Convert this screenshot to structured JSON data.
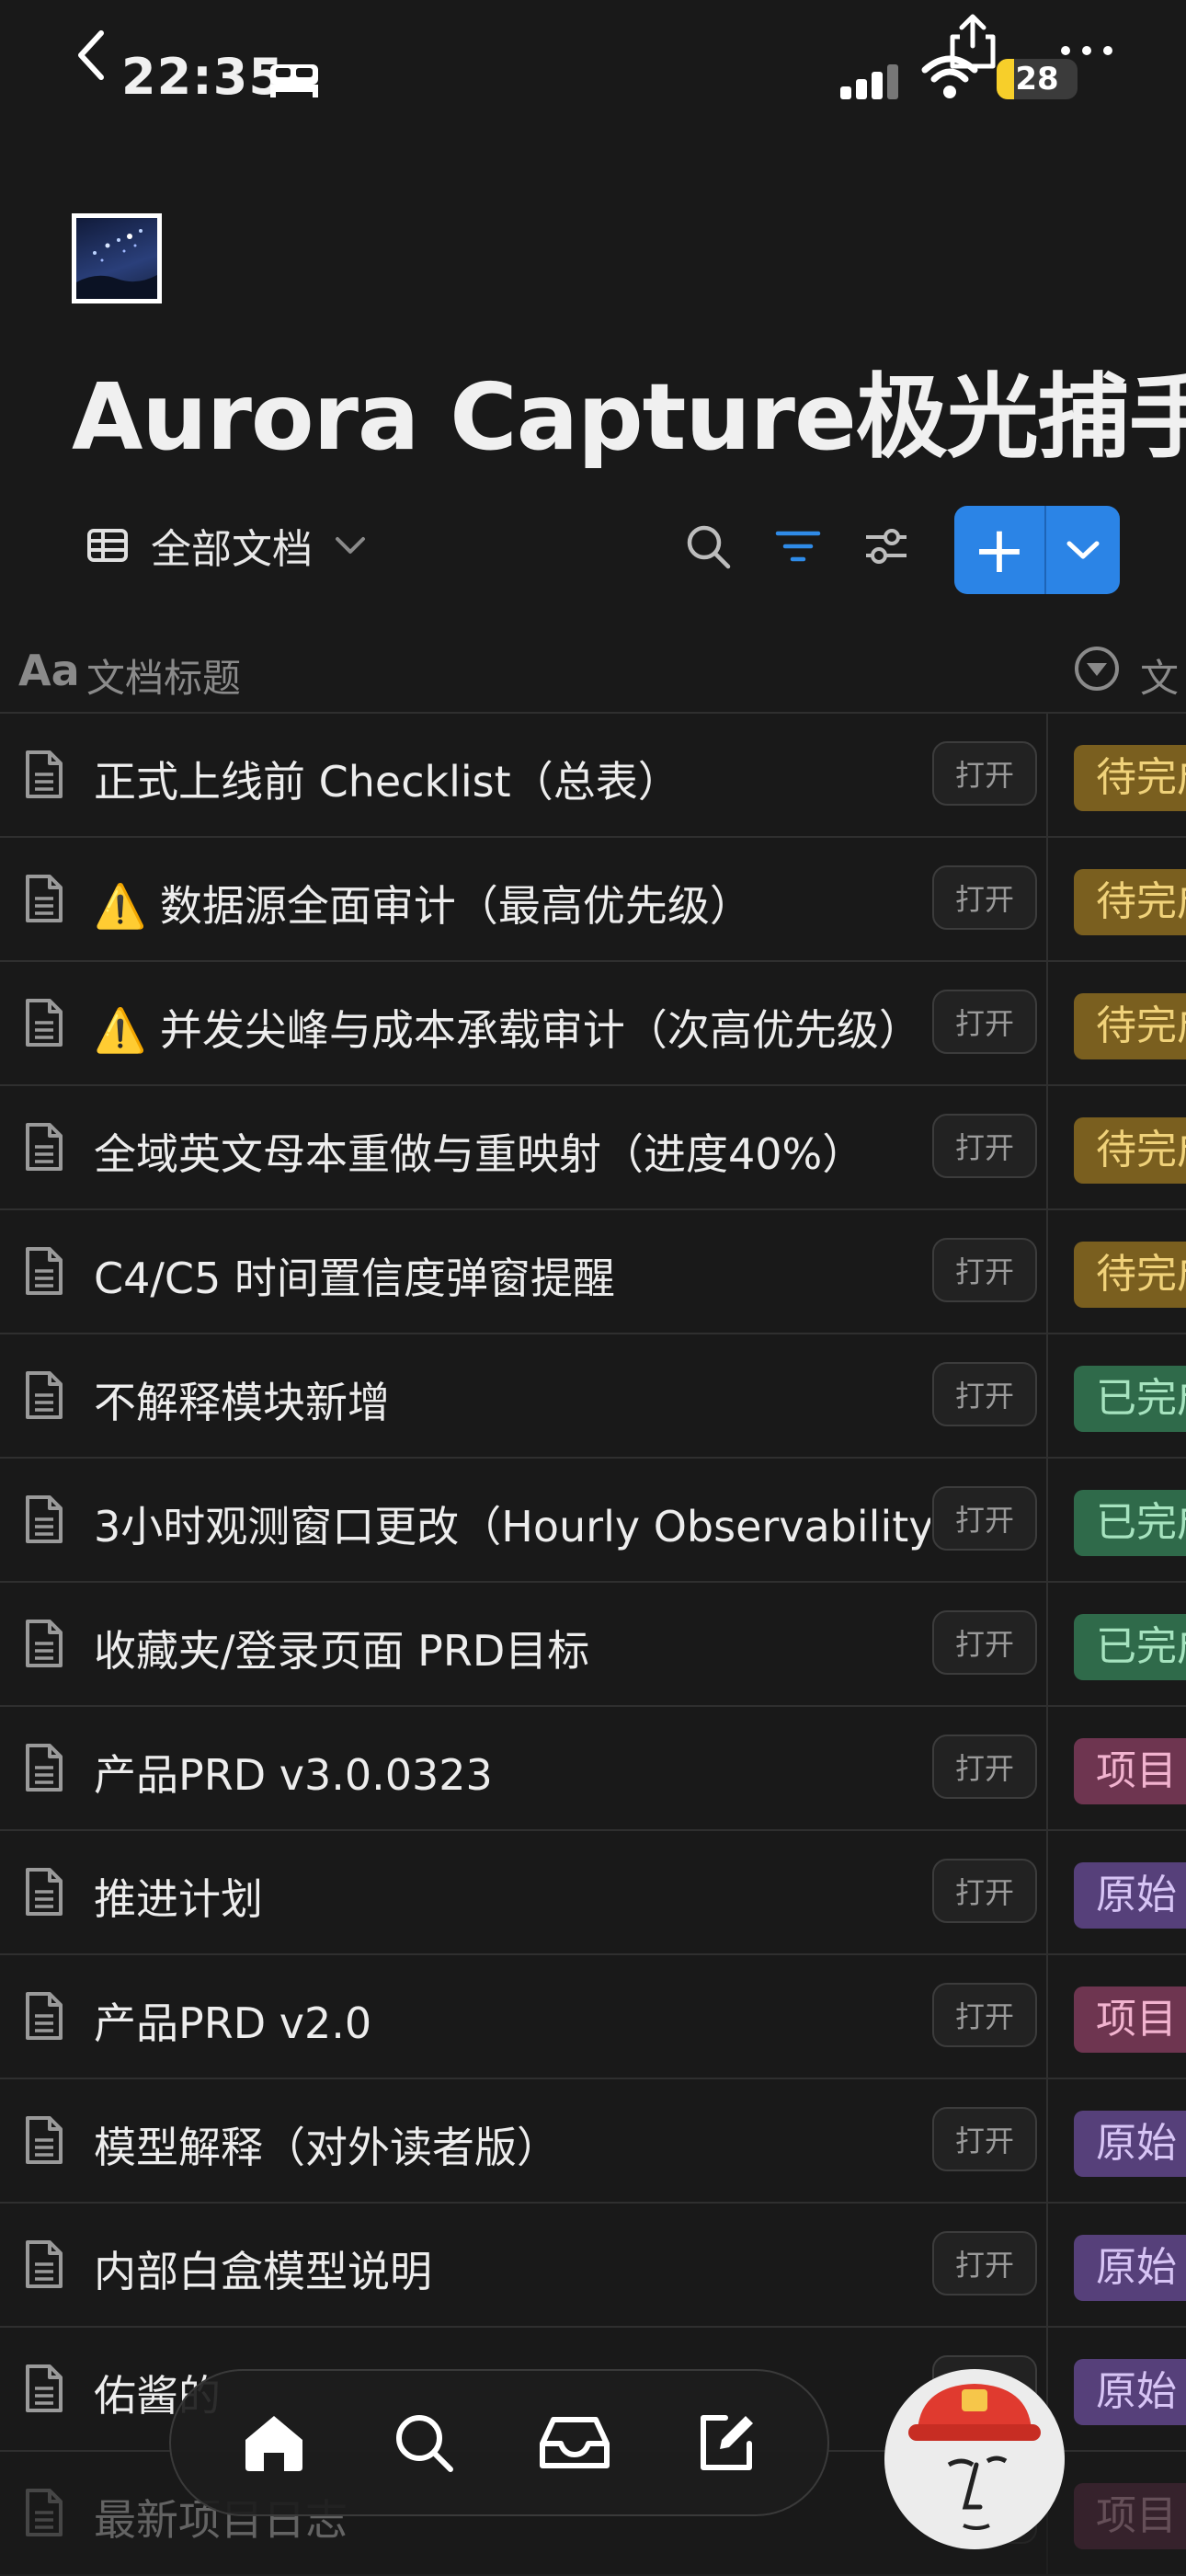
{
  "status_bar": {
    "time": "22:35",
    "battery_level": "28",
    "icons": [
      "back-chevron-icon",
      "bed-icon",
      "share-icon",
      "signal-icon",
      "wifi-icon",
      "more-icon"
    ]
  },
  "page": {
    "title": "Aurora Capture极光捕手",
    "icon": "starry-night-image"
  },
  "toolbar": {
    "view_label": "全部文档",
    "icons": [
      "table-icon",
      "chevron-down-icon",
      "search-icon",
      "filter-icon",
      "sliders-icon",
      "plus-icon"
    ],
    "new_label": "+"
  },
  "table": {
    "col1_icon": "Aa",
    "col1_label": "文档标题",
    "col2_label": "文",
    "open_label": "打开",
    "rows": [
      {
        "title": "正式上线前 Checklist（总表）",
        "status": "待完成",
        "status_color": "#7a5f1f",
        "status_text_color": "#f0d27a"
      },
      {
        "title": "⚠️ 数据源全面审计（最高优先级）",
        "status": "待完成",
        "status_color": "#7a5f1f",
        "status_text_color": "#f0d27a"
      },
      {
        "title": "⚠️ 并发尖峰与成本承载审计（次高优先级）",
        "status": "待完成",
        "status_color": "#7a5f1f",
        "status_text_color": "#f0d27a"
      },
      {
        "title": "全域英文母本重做与重映射（进度40%）",
        "status": "待完成",
        "status_color": "#7a5f1f",
        "status_text_color": "#f0d27a"
      },
      {
        "title": "C4/C5 时间置信度弹窗提醒",
        "status": "待完成",
        "status_color": "#7a5f1f",
        "status_text_color": "#f0d27a"
      },
      {
        "title": "不解释模块新增",
        "status": "已完成",
        "status_color": "#2f6a4a",
        "status_text_color": "#a6e3bf"
      },
      {
        "title": "3小时观测窗口更改（Hourly Observability",
        "status": "已完成",
        "status_color": "#2f6a4a",
        "status_text_color": "#a6e3bf"
      },
      {
        "title": "收藏夹/登录页面 PRD目标",
        "status": "已完成",
        "status_color": "#2f6a4a",
        "status_text_color": "#a6e3bf"
      },
      {
        "title": "产品PRD v3.0.0323",
        "status": "项目",
        "status_color": "#6e3550",
        "status_text_color": "#f2b3cf"
      },
      {
        "title": "推进计划",
        "status": "原始",
        "status_color": "#56407a",
        "status_text_color": "#d7c4f5"
      },
      {
        "title": "产品PRD v2.0",
        "status": "项目",
        "status_color": "#6e3550",
        "status_text_color": "#f2b3cf"
      },
      {
        "title": "模型解释（对外读者版）",
        "status": "原始",
        "status_color": "#56407a",
        "status_text_color": "#d7c4f5"
      },
      {
        "title": "内部白盒模型说明",
        "status": "原始",
        "status_color": "#56407a",
        "status_text_color": "#d7c4f5"
      },
      {
        "title": "佑酱的",
        "status": "原始",
        "status_color": "#56407a",
        "status_text_color": "#d7c4f5"
      },
      {
        "title": "最新项目日志",
        "status": "项目",
        "status_color": "#6e3550",
        "status_text_color": "#f2b3cf"
      }
    ]
  },
  "bottom_nav": {
    "items": [
      "home-icon",
      "search-icon",
      "inbox-icon",
      "compose-icon"
    ]
  },
  "avatar": "firefighter-avatar"
}
